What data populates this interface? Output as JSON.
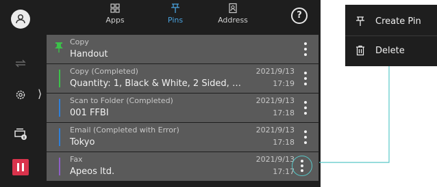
{
  "tabs": [
    {
      "label": "Apps",
      "icon": "apps-icon",
      "active": false
    },
    {
      "label": "Pins",
      "icon": "pin-icon",
      "active": true
    },
    {
      "label": "Address",
      "icon": "address-book-icon",
      "active": false
    }
  ],
  "rows": [
    {
      "name": "Copy",
      "detail": "Handout",
      "date": "",
      "time": "",
      "stripe": "#3cc14a",
      "pinned": true
    },
    {
      "name": "Copy (Completed)",
      "detail": "Quantity: 1, Black & White, 2 Sided, …",
      "date": "2021/9/13",
      "time": "17:19",
      "stripe": "#3cc14a"
    },
    {
      "name": "Scan to Folder (Completed)",
      "detail": "001 FFBI",
      "date": "2021/9/13",
      "time": "17:18",
      "stripe": "#2f7fd8"
    },
    {
      "name": "Email (Completed with Error)",
      "detail": "Tokyo",
      "date": "2021/9/13",
      "time": "17:18",
      "stripe": "#2f7fd8"
    },
    {
      "name": "Fax",
      "detail": "Apeos ltd.",
      "date": "2021/9/13",
      "time": "17:17",
      "stripe": "#8e5fc7"
    }
  ],
  "menu": {
    "create_pin": "Create Pin",
    "delete": "Delete"
  },
  "colors": {
    "accent": "#4aa3df",
    "highlight": "#58c7c7",
    "stop": "#d9334c"
  }
}
